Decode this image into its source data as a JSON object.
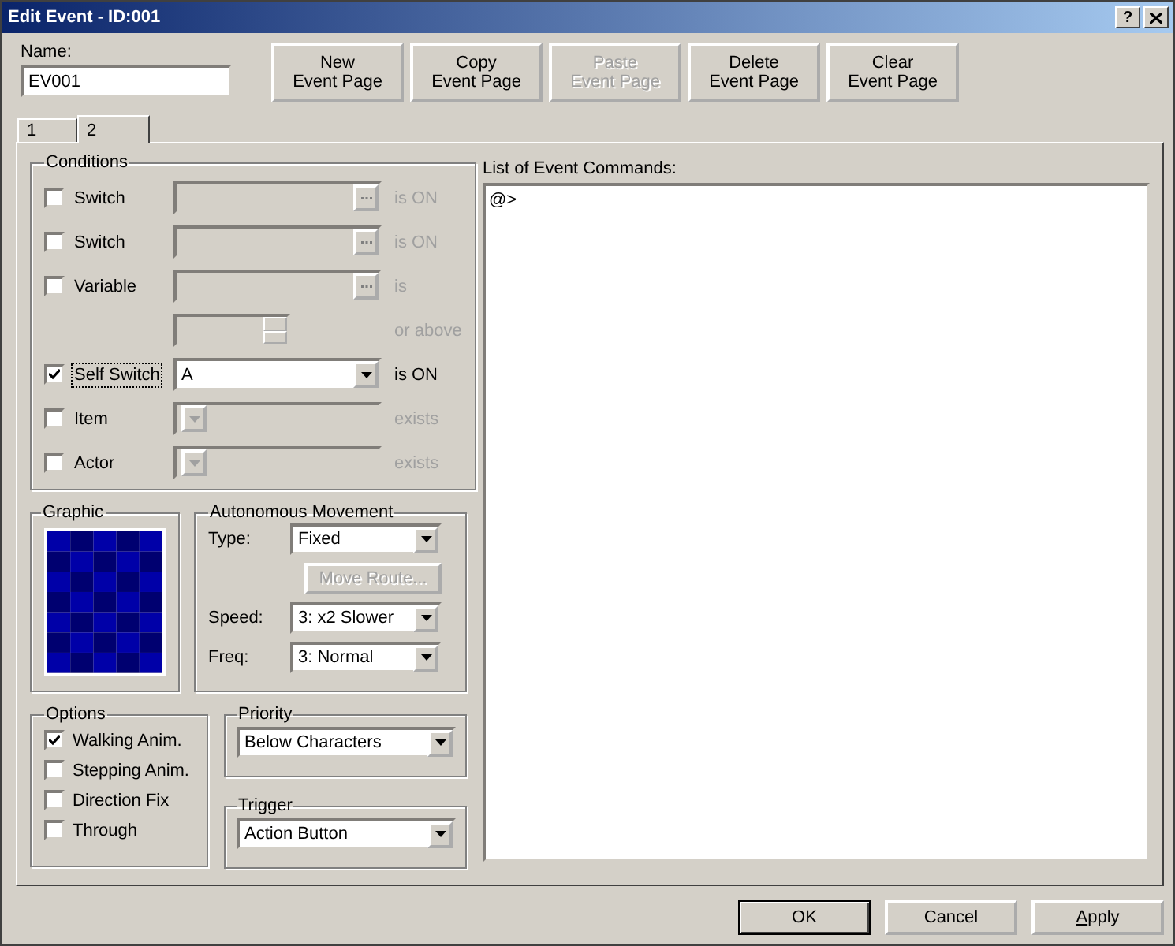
{
  "window": {
    "title": "Edit Event - ID:001",
    "help": "?"
  },
  "name": {
    "label": "Name:",
    "value": "EV001"
  },
  "page_buttons": [
    {
      "lines": [
        "New",
        "Event Page"
      ],
      "disabled": false
    },
    {
      "lines": [
        "Copy",
        "Event Page"
      ],
      "disabled": false
    },
    {
      "lines": [
        "Paste",
        "Event Page"
      ],
      "disabled": true
    },
    {
      "lines": [
        "Delete",
        "Event Page"
      ],
      "disabled": false
    },
    {
      "lines": [
        "Clear",
        "Event Page"
      ],
      "disabled": false
    }
  ],
  "tabs": [
    {
      "label": "1",
      "selected": false
    },
    {
      "label": "2",
      "selected": true
    }
  ],
  "conditions": {
    "title": "Conditions",
    "rows": [
      {
        "kind": "picker",
        "label": "Switch",
        "checked": false,
        "focused": false,
        "disabled": true,
        "suffix": "is ON"
      },
      {
        "kind": "picker",
        "label": "Switch",
        "checked": false,
        "focused": false,
        "disabled": true,
        "suffix": "is ON"
      },
      {
        "kind": "picker",
        "label": "Variable",
        "checked": false,
        "focused": false,
        "disabled": true,
        "suffix": "is"
      },
      {
        "kind": "spin",
        "disabled": true,
        "suffix": "or above"
      },
      {
        "kind": "combo",
        "label": "Self Switch",
        "checked": true,
        "focused": true,
        "disabled": false,
        "value": "A",
        "suffix": "is ON"
      },
      {
        "kind": "combo",
        "label": "Item",
        "checked": false,
        "focused": false,
        "disabled": true,
        "suffix": "exists"
      },
      {
        "kind": "combo",
        "label": "Actor",
        "checked": false,
        "focused": false,
        "disabled": true,
        "suffix": "exists"
      }
    ]
  },
  "graphic": {
    "title": "Graphic"
  },
  "movement": {
    "title": "Autonomous Movement",
    "type": {
      "label": "Type:",
      "value": "Fixed"
    },
    "move_route": {
      "label": "Move Route...",
      "disabled": true
    },
    "speed": {
      "label": "Speed:",
      "value": "3: x2 Slower"
    },
    "freq": {
      "label": "Freq:",
      "value": "3: Normal"
    }
  },
  "options": {
    "title": "Options",
    "items": [
      {
        "label": "Walking Anim.",
        "checked": true
      },
      {
        "label": "Stepping Anim.",
        "checked": false
      },
      {
        "label": "Direction Fix",
        "checked": false
      },
      {
        "label": "Through",
        "checked": false
      }
    ]
  },
  "priority": {
    "title": "Priority",
    "value": "Below Characters"
  },
  "trigger": {
    "title": "Trigger",
    "value": "Action Button"
  },
  "commands": {
    "label": "List of Event Commands:",
    "lines": [
      "@>"
    ]
  },
  "dialog_buttons": [
    {
      "label": "OK",
      "default": true
    },
    {
      "label": "Cancel",
      "default": false
    },
    {
      "mnemonic": "A",
      "label": "pply",
      "default": false
    }
  ]
}
